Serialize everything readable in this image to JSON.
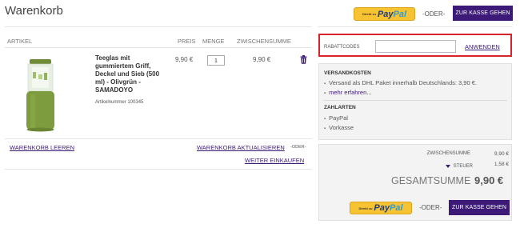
{
  "page": {
    "title": "Warenkorb"
  },
  "checkout": {
    "paypal_small": "Direkt zu",
    "paypal_word_1": "Pay",
    "paypal_word_2": "Pal",
    "or_label": "-ODER-",
    "kasse_label": "ZUR KASSE GEHEN"
  },
  "table": {
    "headers": {
      "artikel": "ARTIKEL",
      "preis": "PREIS",
      "menge": "MENGE",
      "zwischensumme": "ZWISCHENSUMME"
    },
    "item": {
      "name": "Teeglas mit gummiertem Griff, Deckel und Sieb (500 ml) - Olivgrün - SAMADOYO",
      "artnr": "Artikelnummer 100345",
      "price": "9,90 €",
      "qty": "1",
      "subtotal": "9,90 €"
    }
  },
  "cart_actions": {
    "empty": "WARENKORB LEEREN",
    "update": "WARENKORB AKTUALISIEREN",
    "or": "-ODER-",
    "continue": "WEITER EINKAUFEN"
  },
  "coupon": {
    "label": "RABATTCODES",
    "value": "",
    "apply": "ANWENDEN"
  },
  "info": {
    "shipping_heading": "VERSANDKOSTEN",
    "shipping_text": "Versand als DHL Paket innerhalb Deutschlands: 3,90 €.",
    "more_link": "mehr erfahren...",
    "payment_heading": "ZAHLARTEN",
    "payment_methods": [
      "PayPal",
      "Vorkasse"
    ]
  },
  "totals": {
    "subtotal_label": "ZWISCHENSUMME",
    "subtotal_value": "9,90 €",
    "tax_label": "STEUER",
    "tax_value": "1,58 €",
    "grand_label": "GESAMTSUMME",
    "grand_value": "9,90 €"
  },
  "colors": {
    "accent": "#3d1a78",
    "paypal": "#f7c333",
    "highlight": "#d9232a"
  }
}
